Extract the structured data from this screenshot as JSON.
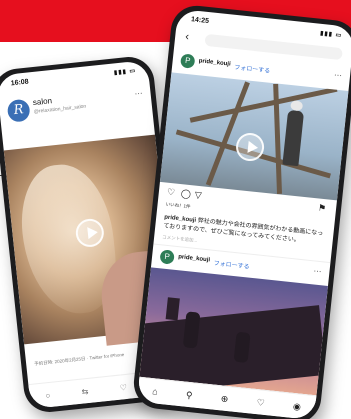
{
  "left_phone": {
    "status": {
      "time": "16:08",
      "signal": "▮▮▮ ▭"
    },
    "account": {
      "avatar_letter": "R",
      "name": "salon",
      "handle": "@relaxation_hair_salon"
    },
    "caption": "予約日時: 2020年2月25日 · Twitter for iPhone",
    "nav": [
      "○",
      "⇆",
      "♡",
      "⇪"
    ]
  },
  "right_phone": {
    "status": {
      "time": "14:25",
      "signal": "▮▮▮ ▭"
    },
    "post1": {
      "user": "pride_kouji",
      "follow": "フォローする"
    },
    "actions": {
      "like": "♡",
      "comment": "◯",
      "share": "▽",
      "save": "⚑"
    },
    "likes": "いいね！1件",
    "caption_user": "pride_kouji",
    "caption_text": "弊社の魅力や会社の雰囲気がわかる動画になっておりますので、ぜひご覧になってみてください。",
    "comment_placeholder": "コメントを追加...",
    "post2": {
      "user": "pride_kouji",
      "follow": "フォローする"
    },
    "nav": [
      "⌂",
      "⚲",
      "⊕",
      "♡",
      "◉"
    ]
  },
  "colors": {
    "band": "#e60f1e",
    "link": "#3a76d8"
  }
}
